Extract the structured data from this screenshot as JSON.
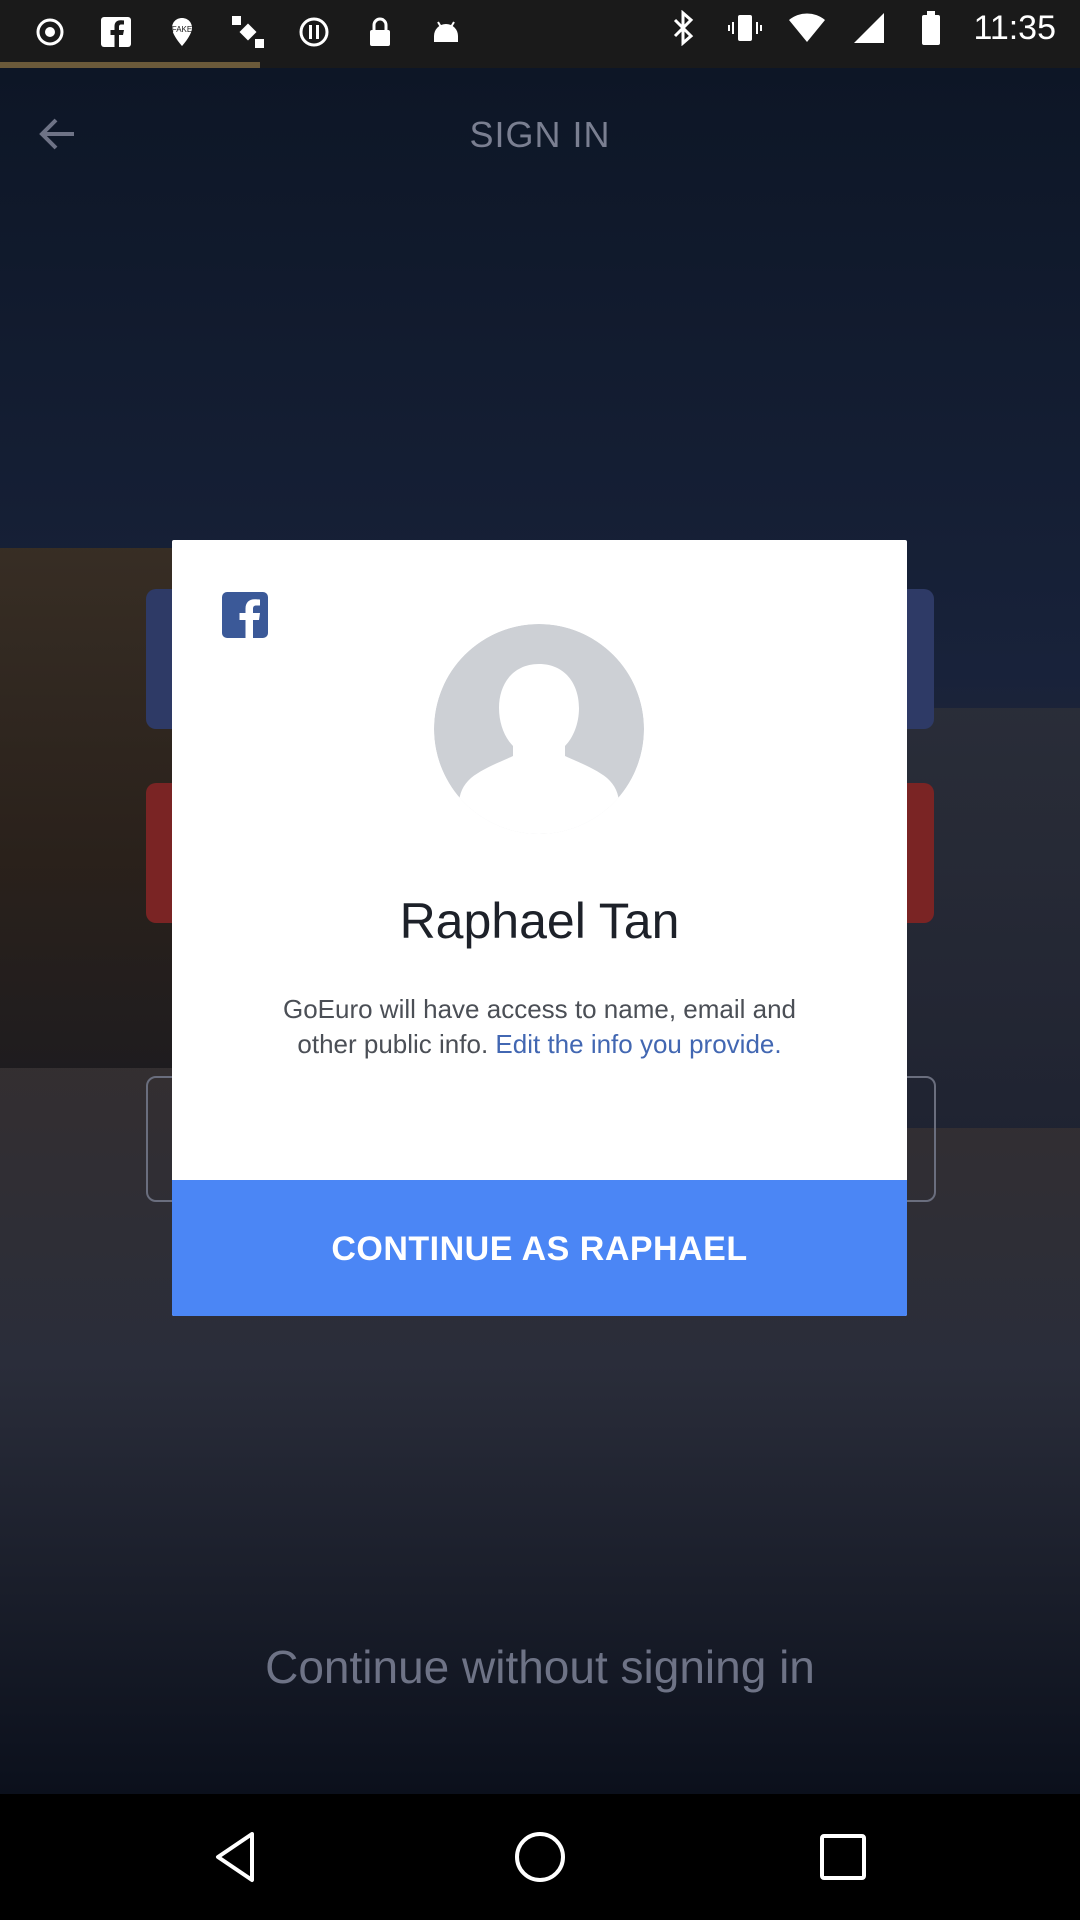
{
  "status_bar": {
    "time": "11:35",
    "left_icons": [
      "record-icon",
      "facebook-icon",
      "fake-gps-icon",
      "satellite-icon",
      "alert-icon",
      "lock-icon",
      "android-icon"
    ],
    "right_icons": [
      "bluetooth-icon",
      "vibrate-icon",
      "wifi-icon",
      "signal-icon",
      "battery-icon"
    ]
  },
  "app": {
    "title": "SIGN IN",
    "back_icon": "arrow-left-icon",
    "continue_without": "Continue without signing in"
  },
  "dialog": {
    "brand_icon": "facebook-icon",
    "user_name": "Raphael Tan",
    "access_text": "GoEuro will have access to name, email and other public info.",
    "edit_link": "Edit the info you provide.",
    "continue_button": "CONTINUE AS RAPHAEL",
    "accent_color": "#4b86f5"
  },
  "nav": {
    "icons": [
      "back-triangle-icon",
      "home-circle-icon",
      "recents-square-icon"
    ]
  }
}
